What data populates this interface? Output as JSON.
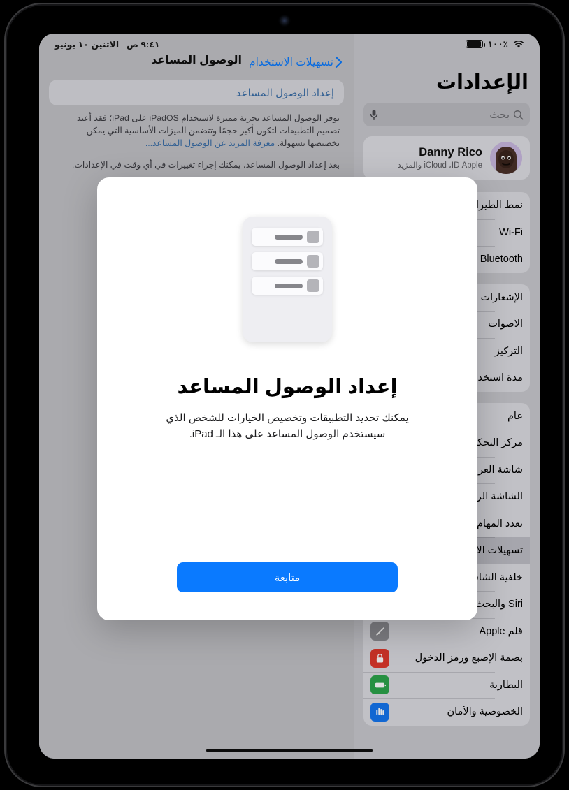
{
  "status_bar": {
    "battery_percent": "١٠٠٪",
    "time": "٩:٤١ ص",
    "date": "الاثنين ١٠ يونيو",
    "battery_icon": "battery-icon",
    "wifi_icon": "wifi-icon"
  },
  "sidebar": {
    "title": "الإعدادات",
    "search": {
      "placeholder": "بحث",
      "search_icon": "search-icon",
      "mic_icon": "microphone-icon"
    },
    "profile": {
      "name": "Danny Rico",
      "subtitle": "Apple ‏ID، ‏iCloud والمزيد"
    },
    "groups": [
      {
        "items": [
          {
            "label": "نمط الطيران",
            "icon": "airplane-icon",
            "color": "#d88211",
            "selected": false
          },
          {
            "label": "Wi‑Fi",
            "icon": "wifi-icon",
            "color": "#1476f0",
            "selected": false
          },
          {
            "label": "Bluetooth",
            "icon": "bluetooth-icon",
            "color": "#1476f0",
            "selected": false
          }
        ]
      },
      {
        "items": [
          {
            "label": "الإشعارات",
            "icon": "bell-icon",
            "color": "#e0382c",
            "selected": false
          },
          {
            "label": "الأصوات",
            "icon": "speaker-waves-icon",
            "color": "#e21f50",
            "selected": false
          },
          {
            "label": "التركيز",
            "icon": "moon-icon",
            "color": "#5a58cc",
            "selected": false
          },
          {
            "label": "مدة استخدام الجهاز",
            "icon": "hourglass-icon",
            "color": "#5a58cc",
            "selected": false
          }
        ]
      },
      {
        "items": [
          {
            "label": "عام",
            "icon": "gear-icon",
            "color": "#8e8e93",
            "selected": false
          },
          {
            "label": "مركز التحكم",
            "icon": "toggles-icon",
            "color": "#8e8e93",
            "selected": false
          },
          {
            "label": "شاشة العرض والسطوع",
            "icon": "brightness-icon",
            "color": "#1476f0",
            "selected": false
          },
          {
            "label": "الشاشة الرئيسية والدوك",
            "icon": "home-screen-icon",
            "color": "#1476f0",
            "selected": false
          },
          {
            "label": "تعدد المهام والإيماءات",
            "icon": "multitasking-icon",
            "color": "#1476f0",
            "selected": false
          },
          {
            "label": "تسهيلات الاستخدام",
            "icon": "accessibility-icon",
            "color": "#1476f0",
            "selected": true
          },
          {
            "label": "خلفية الشاشه",
            "icon": "wallpaper-icon",
            "color": "#2f8fc0",
            "selected": false
          },
          {
            "label": "Siri والبحث",
            "icon": "siri-icon",
            "color": "#1a1a2e",
            "selected": false
          },
          {
            "label": "قلم Apple",
            "icon": "pencil-icon",
            "color": "#8e8e93",
            "selected": false
          },
          {
            "label": "بصمة الإصبع ورمز الدخول",
            "icon": "lock-icon",
            "color": "#e0382c",
            "selected": false
          },
          {
            "label": "البطارية",
            "icon": "battery-icon",
            "color": "#2ca44a",
            "selected": false
          },
          {
            "label": "الخصوصية والأمان",
            "icon": "privacy-hand-icon",
            "color": "#1476f0",
            "selected": false
          }
        ]
      }
    ]
  },
  "detail": {
    "back_label": "تسهيلات الاستخدام",
    "back_icon": "chevron-back-icon",
    "title": "الوصول المساعد",
    "setup_card_label": "إعداد الوصول المساعد",
    "description": "يوفر الوصول المساعد تجربة مميزة لاستخدام iPadOS على iPad؛ فقد أعيد تصميم التطبيقات لتكون أكبر حجمًا وتتضمن الميزات الأساسية التي يمكن تخصيصها بسهولة. ",
    "description_link": "معرفة المزيد عن الوصول المساعد...",
    "note": "بعد إعداد الوصول المساعد، يمكنك إجراء تغييرات في أي وقت في الإعدادات."
  },
  "modal": {
    "illustration_name": "assistive-access-device-illustration",
    "title": "إعداد الوصول المساعد",
    "body": "يمكنك تحديد التطبيقات وتخصيص الخيارات للشخص الذي سيستخدم الوصول المساعد على هذا الـ iPad.",
    "continue_label": "متابعة"
  },
  "colors": {
    "accent": "#0a7aff",
    "screen_background": "#c7c7cc",
    "modal_background": "#ffffff"
  }
}
